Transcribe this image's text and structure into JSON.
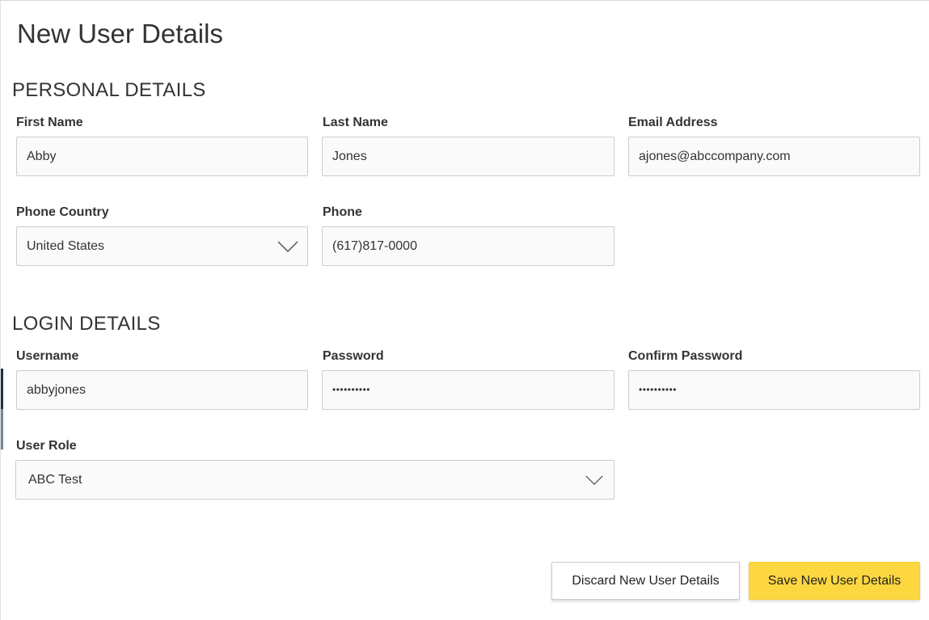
{
  "page": {
    "title": "New User Details"
  },
  "personal": {
    "heading": "PERSONAL DETAILS",
    "first_name": {
      "label": "First Name",
      "value": "Abby"
    },
    "last_name": {
      "label": "Last Name",
      "value": "Jones"
    },
    "email": {
      "label": "Email Address",
      "value": "ajones@abccompany.com"
    },
    "phone_country": {
      "label": "Phone Country",
      "value": "United States",
      "icon": "chevron-down-icon"
    },
    "phone": {
      "label": "Phone",
      "value": "(617)817-0000"
    }
  },
  "login": {
    "heading": "LOGIN DETAILS",
    "username": {
      "label": "Username",
      "value": "abbyjones"
    },
    "password": {
      "label": "Password",
      "value": "••••••••••"
    },
    "confirm_password": {
      "label": "Confirm Password",
      "value": "••••••••••"
    },
    "user_role": {
      "label": "User Role",
      "value": "ABC Test",
      "icon": "chevron-down-icon"
    }
  },
  "actions": {
    "discard_label": "Discard New User Details",
    "save_label": "Save New User Details",
    "save_color": "#fcd740"
  }
}
